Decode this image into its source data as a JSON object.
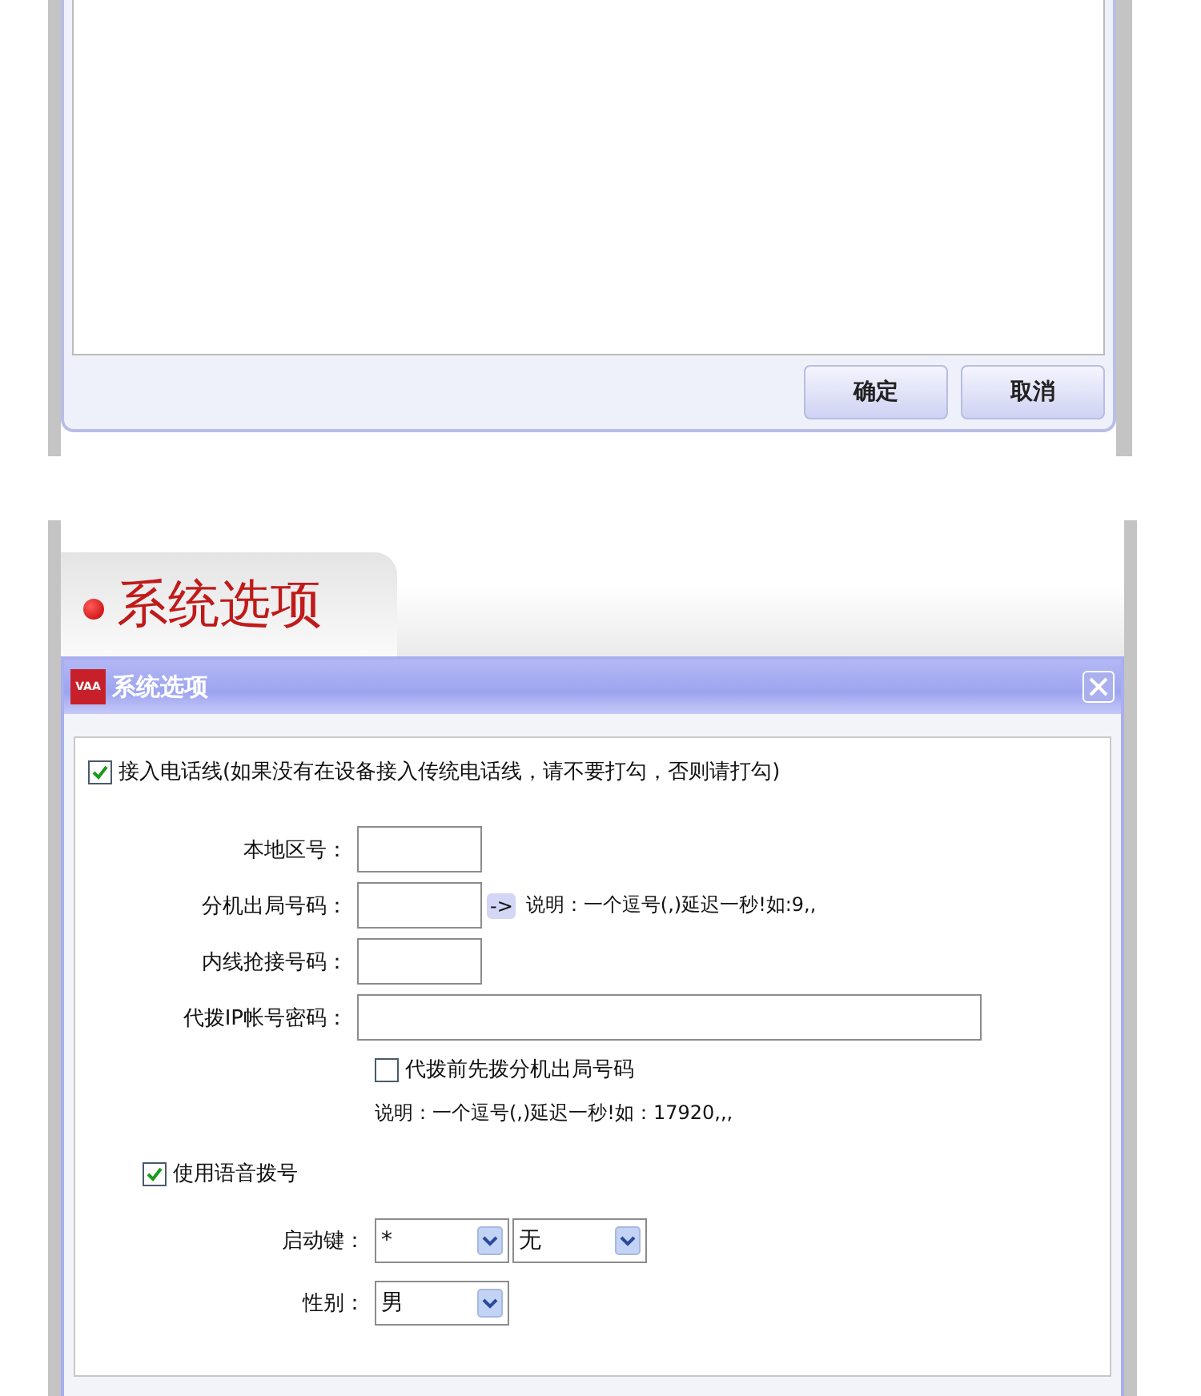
{
  "top_window": {
    "buttons": [
      "确定",
      "取消"
    ]
  },
  "section_heading": "系统选项",
  "dialog": {
    "logo": "VAA",
    "title": "系统选项",
    "phone_line": {
      "label": "接入电话线(如果没有在设备接入传统电话线，请不要打勾，否则请打勾)",
      "checked": true
    },
    "fields": [
      {
        "label": "本地区号：",
        "kind": "short"
      },
      {
        "label": "分机出局号码：",
        "kind": "short",
        "button": "->",
        "note": "说明：一个逗号(,)延迟一秒!如:9,,"
      },
      {
        "label": "内线抢接号码：",
        "kind": "short"
      },
      {
        "label": "代拨IP帐号密码：",
        "kind": "wide"
      }
    ],
    "prefix_checkbox": {
      "label": "代拨前先拨分机出局号码",
      "checked": false
    },
    "note": "说明：一个逗号(,)延迟一秒!如：17920,,,",
    "voice": {
      "label": "使用语音拨号",
      "checked": true
    },
    "selects": [
      {
        "label": "启动键：",
        "values": [
          "*",
          "无"
        ]
      },
      {
        "label": "性别：",
        "values": [
          "男"
        ]
      }
    ]
  }
}
